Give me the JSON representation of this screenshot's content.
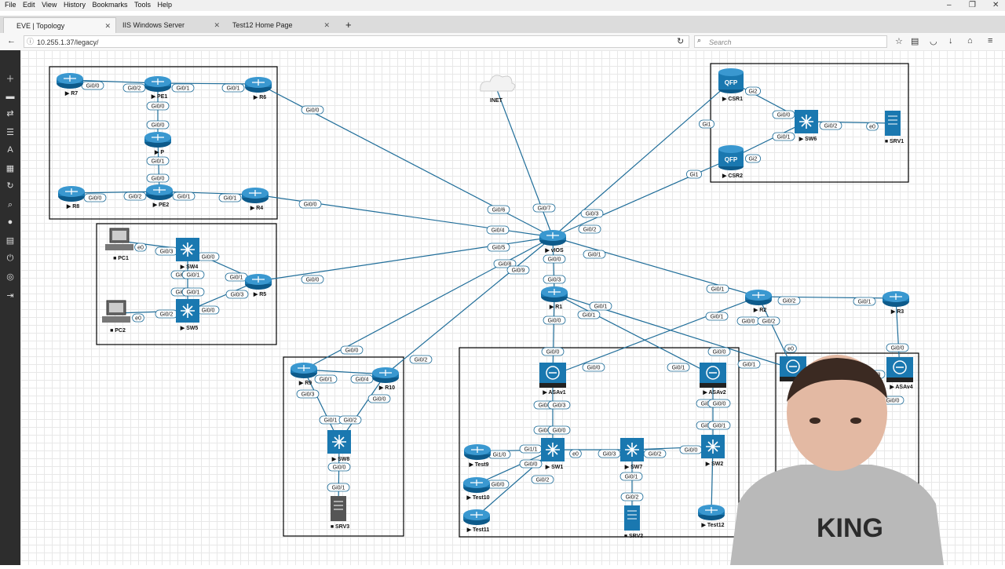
{
  "menu": [
    "File",
    "Edit",
    "View",
    "History",
    "Bookmarks",
    "Tools",
    "Help"
  ],
  "tabs": [
    {
      "label": "EVE | Topology",
      "active": true
    },
    {
      "label": "IIS Windows Server",
      "active": false
    },
    {
      "label": "Test12 Home Page",
      "active": false
    }
  ],
  "nav": {
    "url": "10.255.1.37/legacy/",
    "search_placeholder": "Search"
  },
  "sidebar_icons": [
    "add-icon",
    "node-icon",
    "network-icon",
    "list-icon",
    "text-icon",
    "grid-icon",
    "refresh-icon",
    "zoom-icon",
    "info-icon",
    "log-icon",
    "power-icon",
    "status-icon",
    "logout-icon"
  ],
  "colors": {
    "link": "#1f6d99",
    "device": "#1a78b0",
    "frame": "#000000"
  },
  "nodes": [
    {
      "id": "R7",
      "label": "R7",
      "type": "router"
    },
    {
      "id": "PE1",
      "label": "PE1",
      "type": "router"
    },
    {
      "id": "R6",
      "label": "R6",
      "type": "router"
    },
    {
      "id": "P",
      "label": "P",
      "type": "router"
    },
    {
      "id": "R8",
      "label": "R8",
      "type": "router"
    },
    {
      "id": "PE2",
      "label": "PE2",
      "type": "router"
    },
    {
      "id": "R4",
      "label": "R4",
      "type": "router"
    },
    {
      "id": "PC1",
      "label": "PC1",
      "type": "pc"
    },
    {
      "id": "SW4",
      "label": "SW4",
      "type": "switch"
    },
    {
      "id": "R5",
      "label": "R5",
      "type": "router"
    },
    {
      "id": "PC2",
      "label": "PC2",
      "type": "pc"
    },
    {
      "id": "SW5",
      "label": "SW5",
      "type": "switch"
    },
    {
      "id": "INET",
      "label": "INET",
      "type": "cloud"
    },
    {
      "id": "vIOS",
      "label": "vIOS",
      "type": "router"
    },
    {
      "id": "R1",
      "label": "R1",
      "type": "router"
    },
    {
      "id": "CSR1",
      "label": "CSR1",
      "type": "qfp"
    },
    {
      "id": "CSR2",
      "label": "CSR2",
      "type": "qfp"
    },
    {
      "id": "SW6",
      "label": "SW6",
      "type": "switch"
    },
    {
      "id": "SRV1",
      "label": "SRV1",
      "type": "server"
    },
    {
      "id": "R2",
      "label": "R2",
      "type": "router"
    },
    {
      "id": "R3",
      "label": "R3",
      "type": "router"
    },
    {
      "id": "R9",
      "label": "R9",
      "type": "router"
    },
    {
      "id": "R10",
      "label": "R10",
      "type": "router"
    },
    {
      "id": "SW8",
      "label": "SW8",
      "type": "switch"
    },
    {
      "id": "SRV3",
      "label": "SRV3",
      "type": "server"
    },
    {
      "id": "ASAv1",
      "label": "ASAv1",
      "type": "asa"
    },
    {
      "id": "ASAv2",
      "label": "ASAv2",
      "type": "asa"
    },
    {
      "id": "ASAv3",
      "label": "",
      "type": "asa"
    },
    {
      "id": "ASAv4",
      "label": "ASAv4",
      "type": "asa"
    },
    {
      "id": "SW1",
      "label": "SW1",
      "type": "switch"
    },
    {
      "id": "SW7",
      "label": "SW7",
      "type": "switch"
    },
    {
      "id": "SW2",
      "label": "SW2",
      "type": "switch"
    },
    {
      "id": "Test9",
      "label": "Test9",
      "type": "router"
    },
    {
      "id": "Test10",
      "label": "Test10",
      "type": "router"
    },
    {
      "id": "Test11",
      "label": "Test11",
      "type": "router"
    },
    {
      "id": "SRV2",
      "label": "SRV2",
      "type": "server"
    },
    {
      "id": "Test12",
      "label": "Test12",
      "type": "router"
    }
  ],
  "links": [
    [
      "R7",
      "PE1"
    ],
    [
      "PE1",
      "R6"
    ],
    [
      "PE1",
      "P"
    ],
    [
      "P",
      "PE2"
    ],
    [
      "R8",
      "PE2"
    ],
    [
      "PE2",
      "R4"
    ],
    [
      "PC1",
      "SW4"
    ],
    [
      "SW4",
      "SW5"
    ],
    [
      "SW4",
      "R5"
    ],
    [
      "SW5",
      "R5"
    ],
    [
      "PC2",
      "SW5"
    ],
    [
      "R6",
      "vIOS"
    ],
    [
      "R4",
      "vIOS"
    ],
    [
      "R5",
      "vIOS"
    ],
    [
      "INET",
      "vIOS"
    ],
    [
      "CSR1",
      "vIOS"
    ],
    [
      "CSR2",
      "vIOS"
    ],
    [
      "CSR1",
      "SW6"
    ],
    [
      "CSR2",
      "SW6"
    ],
    [
      "SW6",
      "SRV1"
    ],
    [
      "vIOS",
      "R1"
    ],
    [
      "vIOS",
      "R2"
    ],
    [
      "vIOS",
      "R9"
    ],
    [
      "vIOS",
      "R10"
    ],
    [
      "R2",
      "R3"
    ],
    [
      "R2",
      "ASAv3"
    ],
    [
      "R2",
      "ASAv1"
    ],
    [
      "R3",
      "ASAv4"
    ],
    [
      "R1",
      "ASAv1"
    ],
    [
      "R1",
      "ASAv2"
    ],
    [
      "R1",
      "ASAv3"
    ],
    [
      "R9",
      "R10"
    ],
    [
      "R9",
      "SW8"
    ],
    [
      "R10",
      "SW8"
    ],
    [
      "SW8",
      "SRV3"
    ],
    [
      "ASAv1",
      "SW1"
    ],
    [
      "ASAv2",
      "SW2"
    ],
    [
      "SW1",
      "SW7"
    ],
    [
      "SW7",
      "SW2"
    ],
    [
      "SW7",
      "SRV2"
    ],
    [
      "SW2",
      "Test12"
    ],
    [
      "Test9",
      "SW1"
    ],
    [
      "Test10",
      "SW1"
    ],
    [
      "Test11",
      "SW1"
    ]
  ],
  "port_labels": [
    "Gi0/0",
    "Gi0/2",
    "Gi0/1",
    "Gi0/1",
    "Gi0/0",
    "Gi0/0",
    "Gi0/1",
    "Gi0/0",
    "Gi0/0",
    "Gi0/2",
    "Gi0/1",
    "Gi0/1",
    "e0",
    "Gi0/3",
    "Gi0/0",
    "Gi0/2",
    "Gi0/1",
    "Gi0/2",
    "Gi0/1",
    "Gi0/1",
    "Gi0/3",
    "Gi0/0",
    "Gi0/2",
    "e0",
    "Gi0/0",
    "Gi0/0",
    "Gi0/0",
    "Gi0/6",
    "Gi0/4",
    "Gi0/5",
    "Gi0/7",
    "Gi0/3",
    "Gi0/2",
    "Gi0/1",
    "Gi0/0",
    "Gi0/3",
    "Gi0/8",
    "Gi0/9",
    "Gi1",
    "Gi1",
    "Gi2",
    "Gi2",
    "Gi0/0",
    "Gi0/1",
    "Gi0/2",
    "e0",
    "Gi0/0",
    "Gi0/2",
    "Gi0/1",
    "Gi0/4",
    "Gi0/3",
    "Gi0/0",
    "Gi0/1",
    "Gi0/2",
    "Gi0/0",
    "Gi0/1",
    "Gi0/0",
    "Gi0/1",
    "Gi0/1",
    "Gi0/1",
    "Gi0/2",
    "Gi0/1",
    "Gi0/0",
    "Gi0/2",
    "e0",
    "Gi0/0",
    "Gi0/1",
    "Gi0/0",
    "Gi0/0",
    "Gi0/1",
    "Gi0/0",
    "Gi0/1",
    "Gi0/3",
    "Gi0/0",
    "Gi0/2",
    "Gi0/3",
    "Gi0/2",
    "Gi0/0",
    "Gi0/3",
    "Gi0/0",
    "Gi0/2",
    "Gi0/1",
    "Gi1/0",
    "Gi1/1",
    "Gi0/0",
    "Gi0/0",
    "Gi0/2",
    "e0",
    "Gi0/3",
    "Gi0/2",
    "Gi0/0",
    "Gi0/1",
    "Gi0/2"
  ]
}
